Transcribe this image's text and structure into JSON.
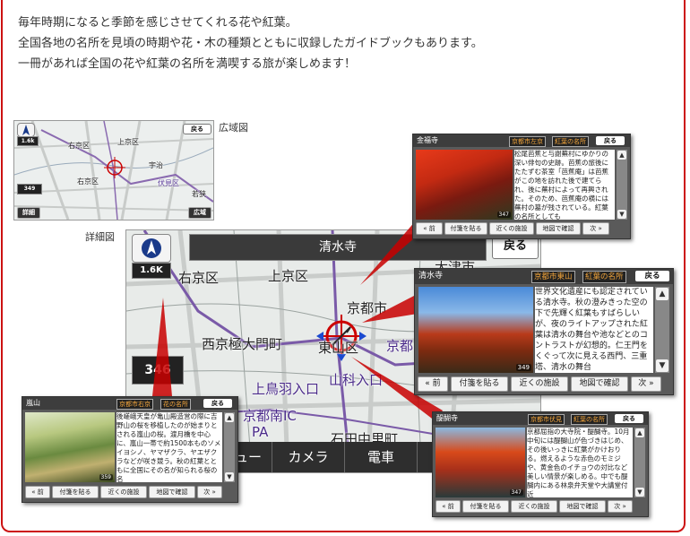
{
  "intro": {
    "line1": "毎年時期になると季節を感じさせてくれる花や紅葉。",
    "line2": "全国各地の名所を見頃の時期や花・木の種類とともに収録したガイドブックもあります。",
    "line3": "一冊があれば全国の花や紅葉の名所を満喫する旅が楽しめます！"
  },
  "labels": {
    "wide": "広域図",
    "detail": "詳細図"
  },
  "wide_map": {
    "scale": "1.6k",
    "distance": "349",
    "back": "戻る",
    "btn_detail": "詳細",
    "btn_wide": "広域",
    "place_labels": [
      "右京区",
      "上京区",
      "右京区",
      "伏見区",
      "若狭",
      "宇治"
    ]
  },
  "detail_map": {
    "title": "清水寺",
    "back": "戻る",
    "scale": "1.6K",
    "distance": "346",
    "place_labels": [
      "右京区",
      "上京区",
      "京都市",
      "大津市",
      "西京極大門町",
      "東山区",
      "京都",
      "上鳥羽入口",
      "山科入口",
      "京都南IC",
      "PA",
      "石田中里町"
    ],
    "bottom_menu": [
      "ュー",
      "カメラ",
      "電車",
      "琵"
    ]
  },
  "panels": {
    "button_labels": [
      "前",
      "付箋を貼る",
      "近くの施設",
      "地図で確認",
      "次"
    ],
    "kinpuku": {
      "title": "金福寺",
      "tag_area": "京都市左京",
      "tag_type": "紅葉の名所",
      "back": "戻る",
      "distance": "347",
      "text": "松尾芭蕉と与謝蕪村にゆかりの深い俳句の史跡。芭蕉の旅後にたたずむ茶室「芭蕉庵」は芭蕉がこの地を訪れた後で建てられ、後に蕪村によって再興された。そのため、芭蕉庵の横には蕪村の墓が残されている。紅葉の名所としても"
    },
    "kiyomizu": {
      "title": "清水寺",
      "tag_area": "京都市東山",
      "tag_type": "紅葉の名所",
      "back": "戻る",
      "distance": "349",
      "text": "世界文化遺産にも認定されている清水寺。秋の澄みきった空の下で先輝く紅葉もすばらしいが、夜のライトアップされた紅葉は清水の舞台や池などとのコントラストが幻想的。仁王門をくぐって次に見える西門、三重塔、清水の舞台"
    },
    "arashiyama": {
      "title": "嵐山",
      "tag_area": "京都市右京",
      "tag_type": "花の名所",
      "back": "戻る",
      "distance": "359",
      "text": "後嵯峨天皇が亀山殿造営の際に吉野山の桜を移植したのが始まりとされる嵐山の桜。渡月橋を中心に、嵐山一帯で約1500本ものソメイヨシノ、ヤマザクラ、ヤエザクラなどが咲き競う。秋の紅葉とともに全国にその名が知られる桜の名"
    },
    "daigo": {
      "title": "醍醐寺",
      "tag_area": "京都市伏見",
      "tag_type": "紅葉の名所",
      "back": "戻る",
      "distance": "347",
      "text": "京都屈指の大寺院・醍醐寺。10月中旬には醍醐山が色づきはじめ、その後いっきに紅葉がかけおりる。燃えるような赤色のモミジや、黄金色のイチョウの対比など美しい情景が楽しめる。中でも醍醐内にある林泉弁天堂や大講堂付近"
    }
  },
  "colors": {
    "frame": "#cc1111",
    "beam": "#c80000",
    "tag_text": "#f3a53b"
  }
}
